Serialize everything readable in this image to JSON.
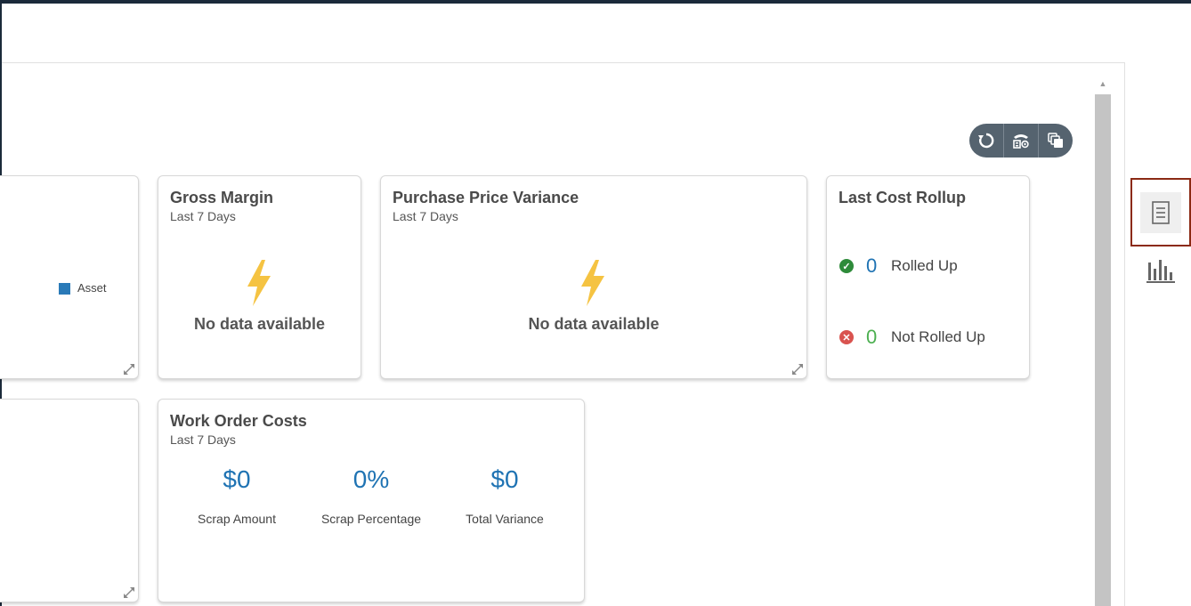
{
  "toolbar": {
    "refresh_icon": "refresh-icon",
    "settings_icon": "settings-icon",
    "layers_icon": "layers-icon"
  },
  "left_card_top": {
    "legend_label": "Asset",
    "legend_color": "#2a7ab8"
  },
  "gross_margin": {
    "title": "Gross Margin",
    "subtitle": "Last 7 Days",
    "no_data": "No data available"
  },
  "ppv": {
    "title": "Purchase Price Variance",
    "subtitle": "Last 7 Days",
    "no_data": "No data available"
  },
  "last_cost_rollup": {
    "title": "Last Cost Rollup",
    "rolled_up_count": "0",
    "rolled_up_label": "Rolled Up",
    "not_rolled_up_count": "0",
    "not_rolled_up_label": "Not Rolled Up",
    "success_color": "#2e8b3a",
    "error_color": "#d9534f"
  },
  "work_order_costs": {
    "title": "Work Order Costs",
    "subtitle": "Last 7 Days",
    "metrics": [
      {
        "value": "$0",
        "label": "Scrap Amount"
      },
      {
        "value": "0%",
        "label": "Scrap Percentage"
      },
      {
        "value": "$0",
        "label": "Total Variance"
      }
    ]
  },
  "side_panel": {
    "list_view_icon": "list-view-icon",
    "chart_view_icon": "chart-view-icon"
  },
  "colors": {
    "accent_blue": "#1f73b3",
    "warning_yellow": "#f5c342",
    "toolbar_bg": "#55636f"
  }
}
